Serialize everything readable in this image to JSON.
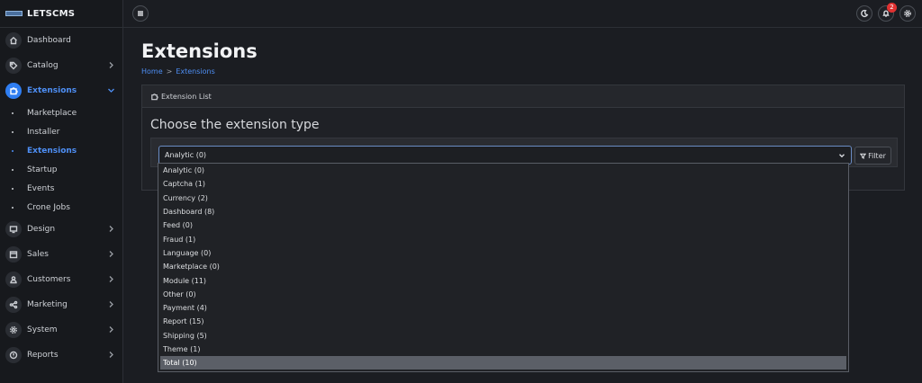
{
  "brand": {
    "name": "LETSCMS"
  },
  "sidebar": {
    "items": [
      {
        "label": "Dashboard",
        "icon": "home-icon",
        "chevron": false
      },
      {
        "label": "Catalog",
        "icon": "tag-icon",
        "chevron": true
      },
      {
        "label": "Extensions",
        "icon": "puzzle-icon",
        "chevron": true,
        "active": true
      },
      {
        "label": "Design",
        "icon": "monitor-icon",
        "chevron": true
      },
      {
        "label": "Sales",
        "icon": "cart-icon",
        "chevron": true
      },
      {
        "label": "Customers",
        "icon": "user-icon",
        "chevron": true
      },
      {
        "label": "Marketing",
        "icon": "share-icon",
        "chevron": true
      },
      {
        "label": "System",
        "icon": "gear-icon",
        "chevron": true
      },
      {
        "label": "Reports",
        "icon": "info-icon",
        "chevron": true
      }
    ],
    "sub_items": [
      {
        "label": "Marketplace"
      },
      {
        "label": "Installer"
      },
      {
        "label": "Extensions",
        "active": true
      },
      {
        "label": "Startup"
      },
      {
        "label": "Events"
      },
      {
        "label": "Crone Jobs"
      }
    ]
  },
  "header": {
    "notification_count": "2"
  },
  "page": {
    "title": "Extensions",
    "breadcrumb": [
      {
        "label": "Home"
      },
      {
        "label": "Extensions"
      }
    ]
  },
  "card": {
    "header": "Extension List",
    "subtitle": "Choose the extension type",
    "select_value": "Analytic (0)",
    "filter_label": "Filter"
  },
  "dropdown": {
    "options": [
      "Analytic (0)",
      "Captcha (1)",
      "Currency (2)",
      "Dashboard (8)",
      "Feed (0)",
      "Fraud (1)",
      "Language (0)",
      "Marketplace (0)",
      "Module (11)",
      "Other (0)",
      "Payment (4)",
      "Report (15)",
      "Shipping (5)",
      "Theme (1)",
      "Total (10)"
    ],
    "highlighted": "Total (10)"
  },
  "colors": {
    "accent": "#2f7ef2",
    "badge": "#e03131"
  }
}
